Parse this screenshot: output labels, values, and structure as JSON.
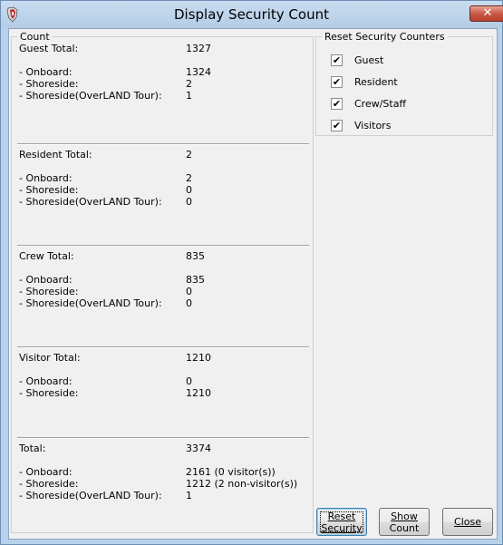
{
  "window": {
    "title": "Display Security Count",
    "close_glyph": "✕"
  },
  "count_group": {
    "legend": "Count",
    "sections": [
      {
        "rows": [
          {
            "label": "Guest Total:",
            "value": "1327"
          },
          {
            "label": "- Onboard:",
            "value": "1324"
          },
          {
            "label": "- Shoreside:",
            "value": "2"
          },
          {
            "label": "- Shoreside(OverLAND Tour):",
            "value": "1"
          }
        ]
      },
      {
        "rows": [
          {
            "label": "Resident Total:",
            "value": "2"
          },
          {
            "label": "- Onboard:",
            "value": "2"
          },
          {
            "label": "- Shoreside:",
            "value": "0"
          },
          {
            "label": "- Shoreside(OverLAND Tour):",
            "value": "0"
          }
        ]
      },
      {
        "rows": [
          {
            "label": "Crew Total:",
            "value": "835"
          },
          {
            "label": "- Onboard:",
            "value": "835"
          },
          {
            "label": "- Shoreside:",
            "value": "0"
          },
          {
            "label": "- Shoreside(OverLAND Tour):",
            "value": "0"
          }
        ]
      },
      {
        "rows": [
          {
            "label": "Visitor Total:",
            "value": "1210"
          },
          {
            "label": "- Onboard:",
            "value": "0"
          },
          {
            "label": "- Shoreside:",
            "value": "1210"
          }
        ]
      },
      {
        "rows": [
          {
            "label": "Total:",
            "value": "3374"
          },
          {
            "label": "- Onboard:",
            "value": "2161 (0 visitor(s))"
          },
          {
            "label": "- Shoreside:",
            "value": "1212 (2 non-visitor(s))"
          },
          {
            "label": "- Shoreside(OverLAND Tour):",
            "value": "1"
          }
        ]
      }
    ]
  },
  "reset_group": {
    "legend": "Reset Security Counters",
    "options": [
      {
        "label": "Guest",
        "checked": true
      },
      {
        "label": "Resident",
        "checked": true
      },
      {
        "label": "Crew/Staff",
        "checked": true
      },
      {
        "label": "Visitors",
        "checked": true
      }
    ],
    "check_glyph": "✔"
  },
  "buttons": {
    "reset_security": {
      "line1": "Reset",
      "line2": "Security"
    },
    "show_count": {
      "line1": "Show",
      "line2": "Count"
    },
    "close": "Close"
  }
}
